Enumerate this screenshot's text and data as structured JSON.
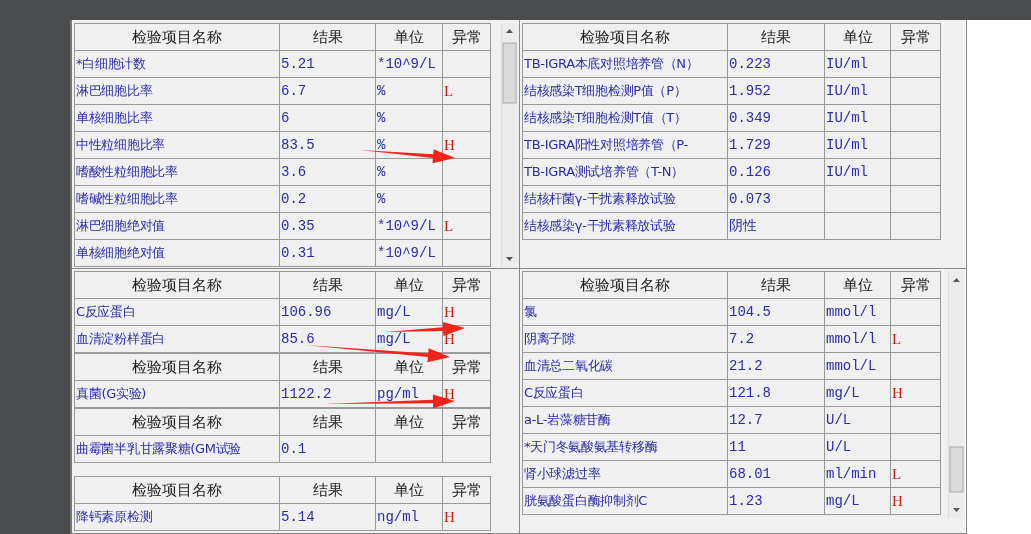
{
  "panels": [
    {
      "tables": [
        {
          "columns": [
            "检验项目名称",
            "结果",
            "单位",
            "异常"
          ],
          "rows": [
            {
              "name": "*白细胞计数",
              "result": "5.21",
              "unit": "*10^9/L"
            },
            {
              "name": "淋巴细胞比率",
              "result": "6.7",
              "unit": "%",
              "flag": "L"
            },
            {
              "name": "单核细胞比率",
              "result": "6",
              "unit": "%"
            },
            {
              "name": "中性粒细胞比率",
              "result": "83.5",
              "unit": "%",
              "flag": "H"
            },
            {
              "name": "嗜酸性粒细胞比率",
              "result": "3.6",
              "unit": "%"
            },
            {
              "name": "嗜碱性粒细胞比率",
              "result": "0.2",
              "unit": "%"
            },
            {
              "name": "淋巴细胞绝对值",
              "result": "0.35",
              "unit": "*10^9/L",
              "flag": "L"
            },
            {
              "name": "单核细胞绝对值",
              "result": "0.31",
              "unit": "*10^9/L"
            }
          ]
        }
      ],
      "scroll": true
    },
    {
      "tables": [
        {
          "columns": [
            "检验项目名称",
            "结果",
            "单位",
            "异常"
          ],
          "rows": [
            {
              "name": "C反应蛋白",
              "result": "106.96",
              "unit": "mg/L",
              "flag": "H"
            },
            {
              "name": "血清淀粉样蛋白",
              "result": "85.6",
              "unit": "mg/L",
              "flag": "H"
            }
          ]
        },
        {
          "columns": [
            "检验项目名称",
            "结果",
            "单位",
            "异常"
          ],
          "rows": [
            {
              "name": "真菌(G实验)",
              "result": "1122.2",
              "unit": "pg/ml",
              "flag": "H"
            }
          ]
        },
        {
          "columns": [
            "检验项目名称",
            "结果",
            "单位",
            "异常"
          ],
          "rows": [
            {
              "name": "曲霉菌半乳甘露聚糖(GM试验",
              "result": "0.1"
            }
          ]
        },
        {
          "columns": [
            "检验项目名称",
            "结果",
            "单位",
            "异常"
          ],
          "rows": [
            {
              "name": "降钙素原检测",
              "result": "5.14",
              "unit": "ng/ml",
              "flag": "H"
            }
          ]
        }
      ],
      "scroll": false
    },
    {
      "tables": [
        {
          "columns": [
            "检验项目名称",
            "结果",
            "单位",
            "异常"
          ],
          "rows": [
            {
              "name": "TB-IGRA本底对照培养管（N）",
              "result": "0.223",
              "unit": "IU/ml"
            },
            {
              "name": "结核感染T细胞检测P值（P）",
              "result": "1.952",
              "unit": "IU/ml"
            },
            {
              "name": "结核感染T细胞检测T值（T）",
              "result": "0.349",
              "unit": "IU/ml"
            },
            {
              "name": "TB-IGRA阳性对照培养管（P-",
              "result": "1.729",
              "unit": "IU/ml"
            },
            {
              "name": "TB-IGRA测试培养管（T-N）",
              "result": "0.126",
              "unit": "IU/ml"
            },
            {
              "name": "结核杆菌γ-干扰素释放试验",
              "result": "0.073"
            },
            {
              "name": "结核感染γ-干扰素释放试验",
              "result": "阴性"
            }
          ]
        }
      ],
      "scroll": false
    },
    {
      "tables": [
        {
          "columns": [
            "检验项目名称",
            "结果",
            "单位",
            "异常"
          ],
          "rows": [
            {
              "name": "氯",
              "result": "104.5",
              "unit": "mmol/l"
            },
            {
              "name": "阴离子隙",
              "result": "7.2",
              "unit": "mmol/l",
              "flag": "L"
            },
            {
              "name": "血清总二氧化碳",
              "result": "21.2",
              "unit": "mmol/L"
            },
            {
              "name": "C反应蛋白",
              "result": "121.8",
              "unit": "mg/L",
              "flag": "H"
            },
            {
              "name": "a-L-岩藻糖苷酶",
              "result": "12.7",
              "unit": "U/L"
            },
            {
              "name": "*天门冬氨酸氨基转移酶",
              "result": "11",
              "unit": "U/L"
            },
            {
              "name": "肾小球滤过率",
              "result": "68.01",
              "unit": "ml/min",
              "flag": "L"
            },
            {
              "name": "胱氨酸蛋白酶抑制剂C",
              "result": "1.23",
              "unit": "mg/L",
              "flag": "H"
            }
          ]
        }
      ],
      "scroll": true
    }
  ]
}
